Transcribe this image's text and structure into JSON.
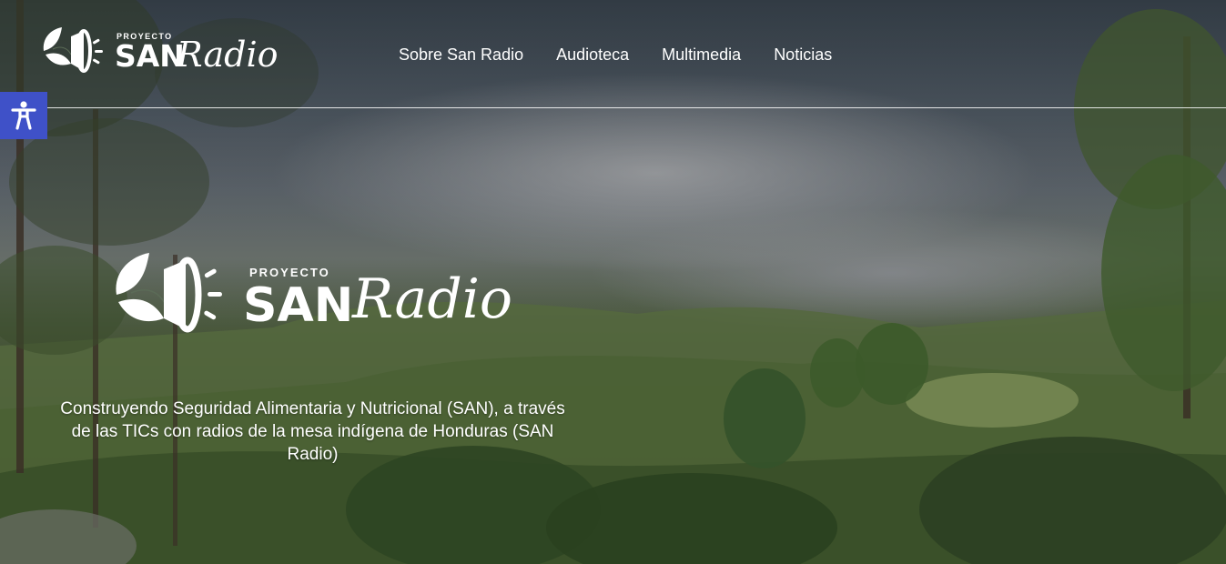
{
  "brand": {
    "small_proyecto": "PROYECTO",
    "small_san": "SAN",
    "small_radio": "Radio",
    "big_proyecto": "PROYECTO",
    "big_san": "SAN",
    "big_radio": "Radio",
    "logo_icon": "leaves-megaphone-icon"
  },
  "nav": {
    "items": [
      {
        "label": "Sobre San Radio"
      },
      {
        "label": "Audioteca"
      },
      {
        "label": "Multimedia"
      },
      {
        "label": "Noticias"
      }
    ]
  },
  "accessibility": {
    "icon": "accessibility-person-icon",
    "color": "#3f51c8"
  },
  "hero": {
    "tagline": "Construyendo Seguridad Alimentaria y Nutricional (SAN), a través de las TICs con radios de la mesa indígena de Honduras (SAN Radio)"
  }
}
